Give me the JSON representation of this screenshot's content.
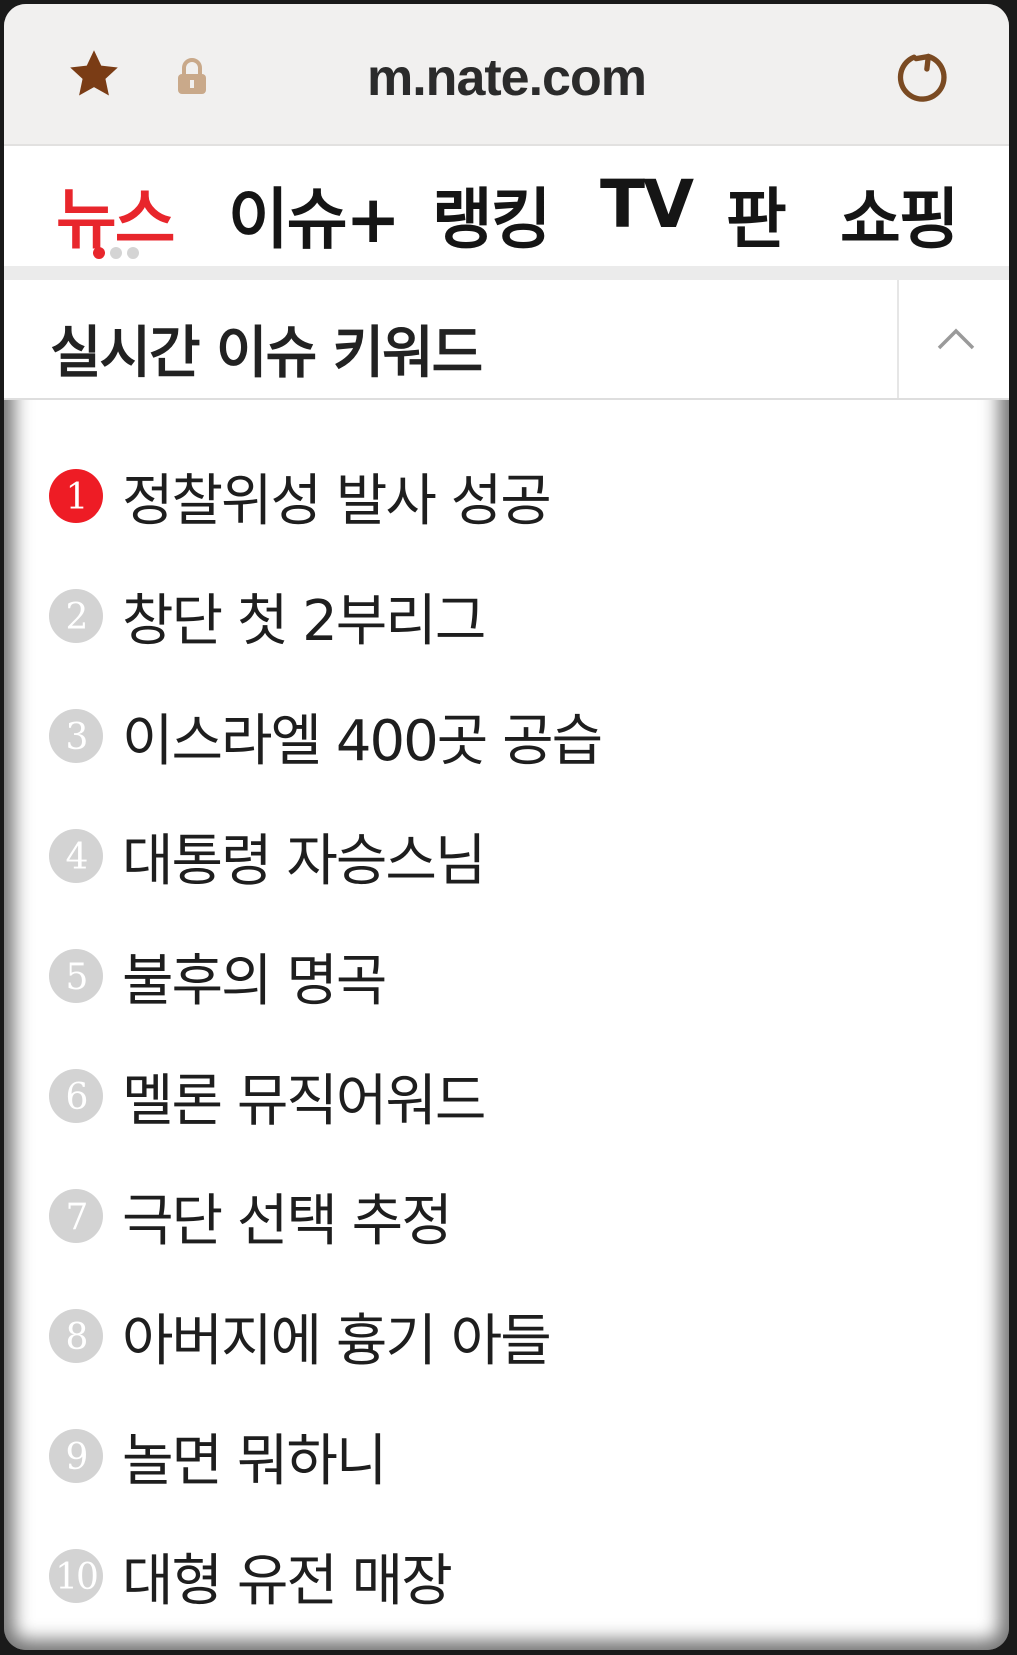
{
  "browser": {
    "url": "m.nate.com",
    "icons": {
      "bookmark": "star-icon",
      "secure": "lock-icon",
      "reload": "reload-icon"
    },
    "colors": {
      "star": "#7a3c15",
      "reload": "#7a4a22"
    }
  },
  "nav": {
    "tabs": [
      {
        "label": "뉴스",
        "active": true
      },
      {
        "label": "이슈+"
      },
      {
        "label": "랭킹"
      },
      {
        "label": "TV"
      },
      {
        "label": "판"
      },
      {
        "label": "쇼핑"
      }
    ],
    "accent_color": "#e8262c"
  },
  "keywords": {
    "title": "실시간 이슈 키워드",
    "collapse_icon": "chevron-up-icon",
    "items": [
      {
        "rank": "1",
        "text": "정찰위성 발사 성공"
      },
      {
        "rank": "2",
        "text": "창단 첫 2부리그"
      },
      {
        "rank": "3",
        "text": "이스라엘 400곳 공습"
      },
      {
        "rank": "4",
        "text": "대통령 자승스님"
      },
      {
        "rank": "5",
        "text": "불후의 명곡"
      },
      {
        "rank": "6",
        "text": "멜론 뮤직어워드"
      },
      {
        "rank": "7",
        "text": "극단 선택 추정"
      },
      {
        "rank": "8",
        "text": "아버지에 흉기 아들"
      },
      {
        "rank": "9",
        "text": "놀면 뭐하니"
      },
      {
        "rank": "10",
        "text": "대형 유전 매장"
      }
    ]
  }
}
